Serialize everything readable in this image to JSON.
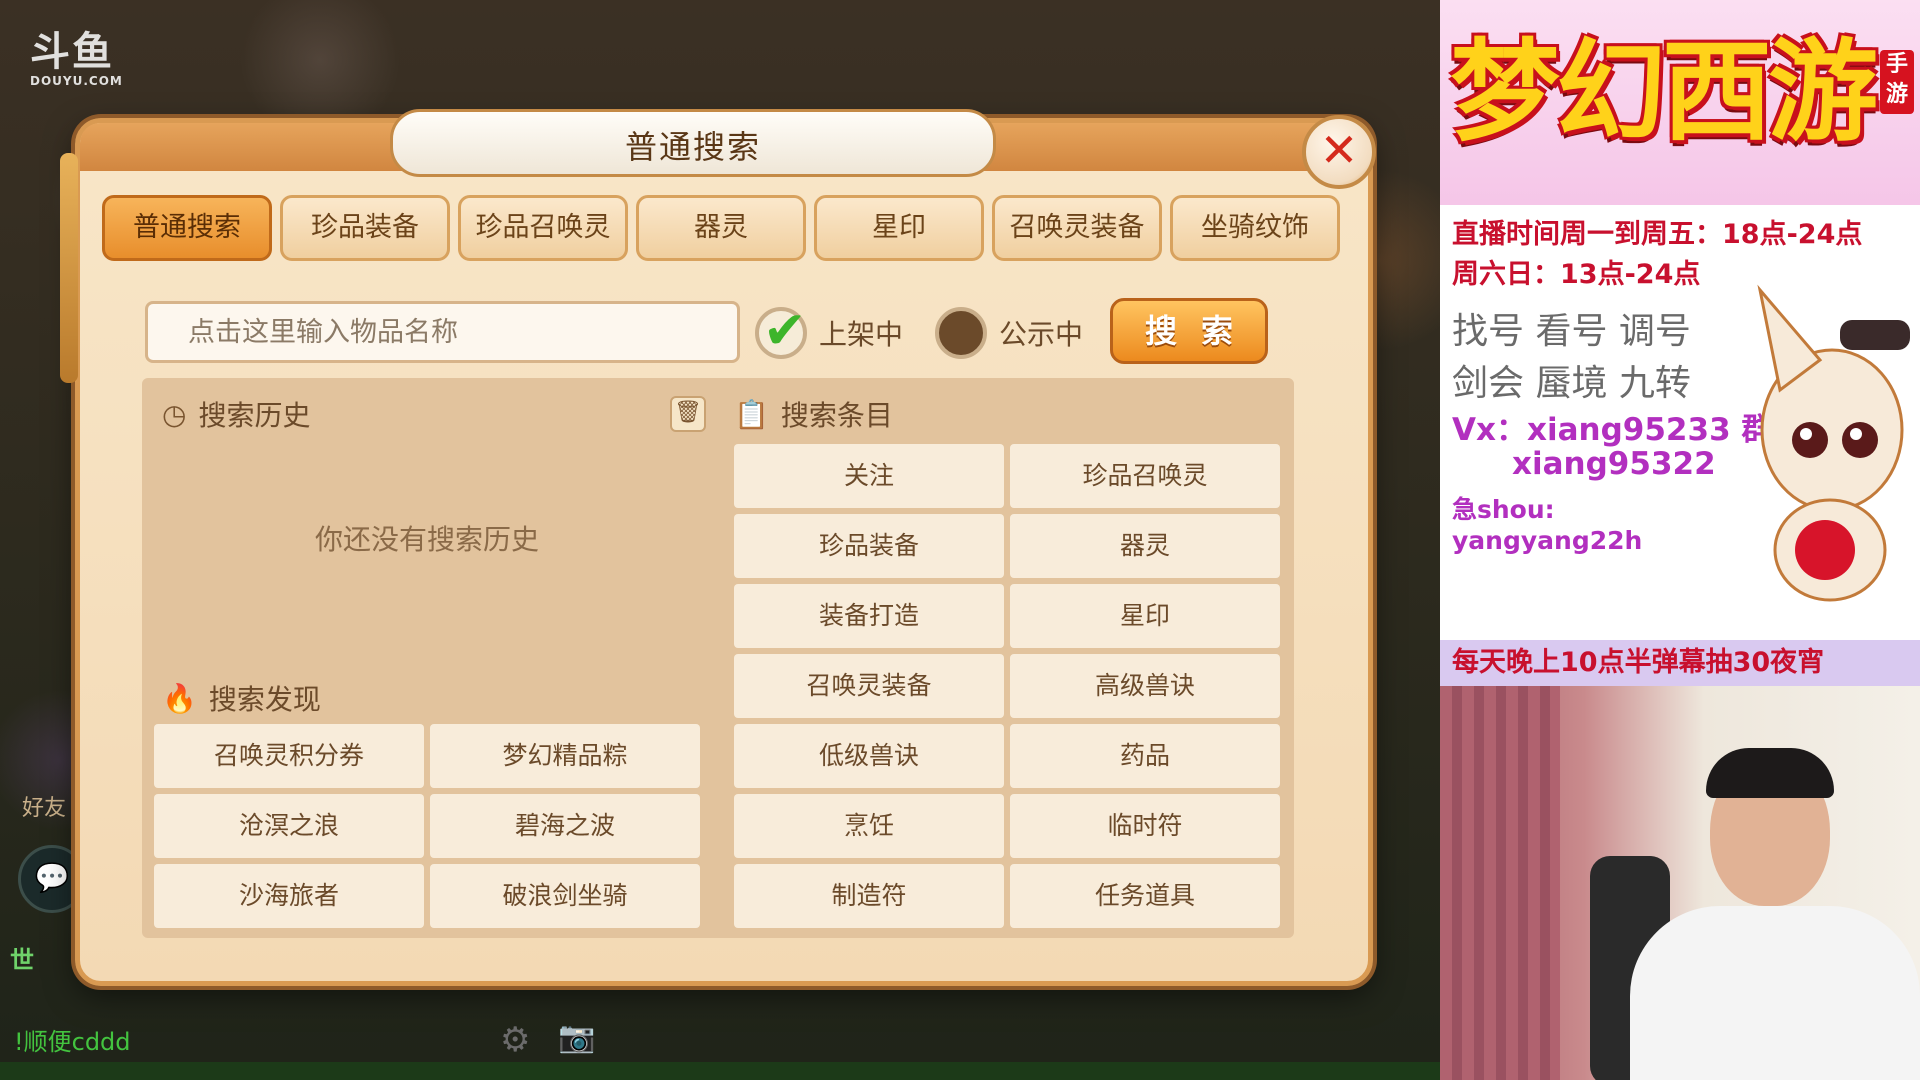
{
  "watermark": {
    "logo_cn": "斗鱼",
    "logo_en": "DOUYU.COM"
  },
  "dialog": {
    "title": "普通搜索",
    "close_glyph": "✕",
    "tabs": [
      {
        "label": "普通搜索",
        "active": true
      },
      {
        "label": "珍品装备",
        "active": false
      },
      {
        "label": "珍品召唤灵",
        "active": false
      },
      {
        "label": "器灵",
        "active": false
      },
      {
        "label": "星印",
        "active": false
      },
      {
        "label": "召唤灵装备",
        "active": false
      },
      {
        "label": "坐骑纹饰",
        "active": false
      }
    ],
    "search": {
      "placeholder": "点击这里输入物品名称",
      "value": "",
      "button_label": "搜索"
    },
    "filters": [
      {
        "label": "上架中",
        "checked": true
      },
      {
        "label": "公示中",
        "checked": false
      }
    ],
    "history": {
      "title": "搜索历史",
      "empty_text": "你还没有搜索历史"
    },
    "discover": {
      "title": "搜索发现",
      "items": [
        "召唤灵积分券",
        "梦幻精品粽",
        "沧溟之浪",
        "碧海之波",
        "沙海旅者",
        "破浪剑坐骑"
      ]
    },
    "items_section": {
      "title": "搜索条目",
      "items": [
        "关注",
        "珍品召唤灵",
        "珍品装备",
        "器灵",
        "装备打造",
        "星印",
        "召唤灵装备",
        "高级兽诀",
        "低级兽诀",
        "药品",
        "烹饪",
        "临时符",
        "制造符",
        "任务道具"
      ]
    }
  },
  "game_hud": {
    "friend_label": "好友",
    "world_label": "世",
    "chat_line": "!顺便cddd"
  },
  "stream_overlay": {
    "banner_title": "梦幻西游",
    "banner_tag": "手游",
    "lines": [
      "直播时间周一到周五：18点-24点",
      "周六日：13点-24点",
      "找号 看号 调号",
      "剑会 蜃境 九转",
      "Vx：xiang95233 群",
      "xiang95322",
      "急shou:",
      "yangyang22h"
    ],
    "promo": "每天晚上10点半弹幕抽30夜宵"
  },
  "colors": {
    "accent_orange": "#e88e2c",
    "close_red": "#d42a1c",
    "check_green": "#3db52b",
    "overlay_red": "#c8102e",
    "overlay_purple": "#b22fbf"
  }
}
